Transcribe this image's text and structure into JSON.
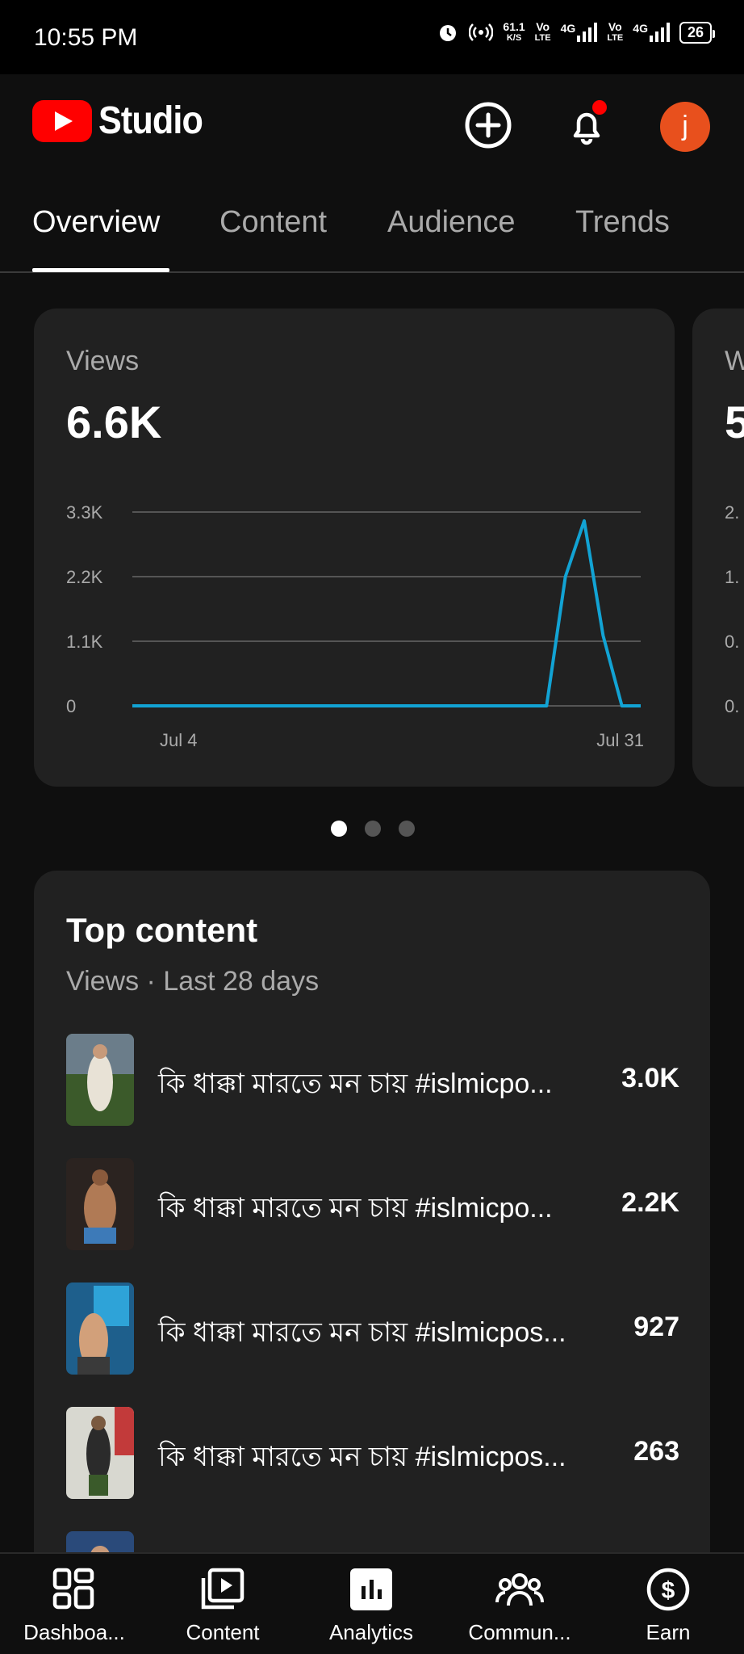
{
  "status_bar": {
    "time": "10:55 PM",
    "net_speed": "61.1",
    "net_unit": "K/S",
    "vo1": "Vo",
    "lte1": "LTE",
    "g1": "4G",
    "vo2": "Vo",
    "lte2": "LTE",
    "g2": "4G",
    "battery": "26"
  },
  "header": {
    "app_name": "Studio",
    "avatar_letter": "j"
  },
  "tabs": [
    {
      "label": "Overview",
      "active": true
    },
    {
      "label": "Content",
      "active": false
    },
    {
      "label": "Audience",
      "active": false
    },
    {
      "label": "Trends",
      "active": false
    }
  ],
  "views_card": {
    "label": "Views",
    "value": "6.6K"
  },
  "peek_card": {
    "label": "W",
    "value": "5",
    "ticks": [
      "2.",
      "1.",
      "0.",
      "0."
    ]
  },
  "chart_data": {
    "type": "line",
    "x_labels": [
      "Jul 4",
      "Jul 31"
    ],
    "x": [
      "Jul 4",
      "Jul 5",
      "Jul 6",
      "Jul 7",
      "Jul 8",
      "Jul 9",
      "Jul 10",
      "Jul 11",
      "Jul 12",
      "Jul 13",
      "Jul 14",
      "Jul 15",
      "Jul 16",
      "Jul 17",
      "Jul 18",
      "Jul 19",
      "Jul 20",
      "Jul 21",
      "Jul 22",
      "Jul 23",
      "Jul 24",
      "Jul 25",
      "Jul 26",
      "Jul 27",
      "Jul 28",
      "Jul 29",
      "Jul 30",
      "Jul 31"
    ],
    "series": [
      {
        "values": [
          0,
          0,
          0,
          0,
          0,
          0,
          0,
          0,
          0,
          0,
          0,
          0,
          0,
          0,
          0,
          0,
          0,
          0,
          0,
          0,
          0,
          0,
          0,
          2200,
          3150,
          1200,
          0,
          0
        ]
      }
    ],
    "y_ticks": [
      "0",
      "1.1K",
      "2.2K",
      "3.3K"
    ],
    "ylim": [
      0,
      3300
    ],
    "grid": true,
    "color": "#12a3d4"
  },
  "pager": {
    "count": 3,
    "active": 0
  },
  "top_content": {
    "title": "Top content",
    "subtitle": "Views · Last 28 days",
    "items": [
      {
        "title": "কি ধাক্কা মারতে মন চায় #islmicpo...",
        "views": "3.0K"
      },
      {
        "title": "কি ধাক্কা মারতে মন চায় #islmicpo...",
        "views": "2.2K"
      },
      {
        "title": "কি ধাক্কা মারতে মন চায় #islmicpos...",
        "views": "927"
      },
      {
        "title": "কি ধাক্কা মারতে মন চায় #islmicpos...",
        "views": "263"
      }
    ]
  },
  "bottom_nav": [
    {
      "label": "Dashboa...",
      "icon": "dashboard-icon"
    },
    {
      "label": "Content",
      "icon": "content-icon"
    },
    {
      "label": "Analytics",
      "icon": "analytics-icon",
      "active": true
    },
    {
      "label": "Commun...",
      "icon": "community-icon"
    },
    {
      "label": "Earn",
      "icon": "earn-icon"
    }
  ],
  "colors": {
    "background": "#0f0f0f",
    "card": "#212121",
    "accent_line": "#12a3d4",
    "brand_red": "#ff0000",
    "avatar": "#e8501d"
  }
}
